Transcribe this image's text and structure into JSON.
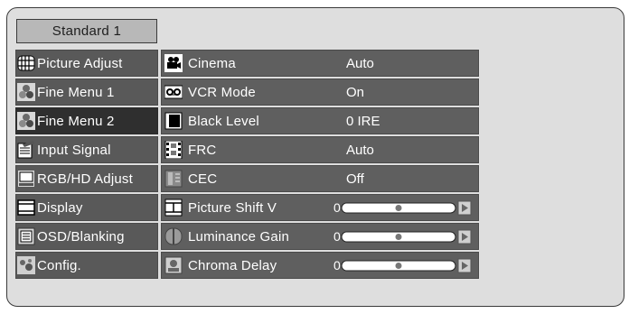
{
  "mode_tab": "Standard 1",
  "sidebar": [
    {
      "label": "Picture Adjust",
      "icon": "grid-icon"
    },
    {
      "label": "Fine Menu 1",
      "icon": "fine-menu-icon"
    },
    {
      "label": "Fine Menu 2",
      "icon": "fine-menu-icon",
      "active": true
    },
    {
      "label": "Input Signal",
      "icon": "input-signal-icon"
    },
    {
      "label": "RGB/HD Adjust",
      "icon": "monitor-icon"
    },
    {
      "label": "Display",
      "icon": "display-icon"
    },
    {
      "label": "OSD/Blanking",
      "icon": "osd-icon"
    },
    {
      "label": "Config.",
      "icon": "config-icon"
    }
  ],
  "menu": [
    {
      "label": "Cinema",
      "value": "Auto",
      "icon": "camera-icon"
    },
    {
      "label": "VCR Mode",
      "value": "On",
      "icon": "vcr-icon"
    },
    {
      "label": "Black Level",
      "value": "0 IRE",
      "icon": "black-level-icon"
    },
    {
      "label": "FRC",
      "value": "Auto",
      "icon": "film-icon"
    },
    {
      "label": "CEC",
      "value": "Off",
      "icon": "cec-icon"
    },
    {
      "label": "Picture Shift V",
      "value": "0",
      "icon": "shift-icon",
      "slider": true,
      "level": 0.5
    },
    {
      "label": "Luminance Gain",
      "value": "0",
      "icon": "luminance-icon",
      "slider": true,
      "level": 0.5
    },
    {
      "label": "Chroma Delay",
      "value": "0",
      "icon": "chroma-icon",
      "slider": true,
      "level": 0.5
    }
  ]
}
